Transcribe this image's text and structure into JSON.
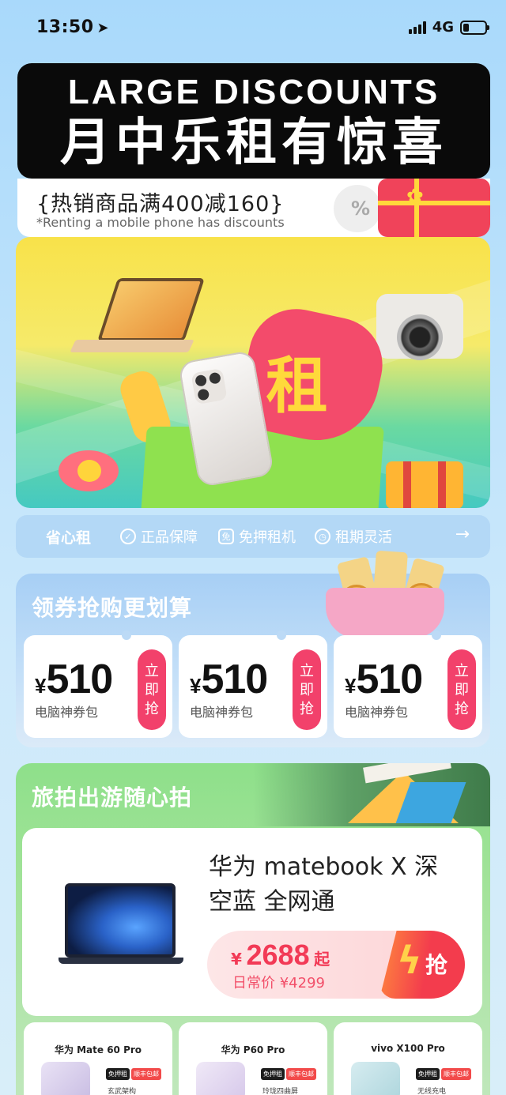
{
  "status_bar": {
    "time": "13:50",
    "network": "4G",
    "battery_level": 0.25
  },
  "headline": {
    "english": "LARGE DISCOUNTS",
    "chinese": "月中乐租有惊喜"
  },
  "promo": {
    "main": "{热销商品满400减160}",
    "sub": "*Renting a mobile phone has discounts",
    "deco_symbol": "%"
  },
  "hero": {
    "sign_char": "租"
  },
  "service_bar": {
    "brand": "省心租",
    "items": [
      {
        "icon": "shield-check-icon",
        "label": "正品保障"
      },
      {
        "icon": "deposit-free-icon",
        "label": "免押租机"
      },
      {
        "icon": "clock-icon",
        "label": "租期灵活"
      }
    ],
    "arrow": "→"
  },
  "coupons": {
    "title": "领券抢购更划算",
    "items": [
      {
        "currency": "¥",
        "amount": "510",
        "label": "电脑神券包",
        "button": "立即抢"
      },
      {
        "currency": "¥",
        "amount": "510",
        "label": "电脑神券包",
        "button": "立即抢"
      },
      {
        "currency": "¥",
        "amount": "510",
        "label": "电脑神券包",
        "button": "立即抢"
      }
    ]
  },
  "travel": {
    "title": "旅拍出游随心拍",
    "featured": {
      "name": "华为 matebook X 深空蓝 全网通",
      "currency": "¥",
      "price": "2688",
      "price_suffix": "起",
      "original_price": "日常价 ¥4299",
      "button": "抢"
    },
    "minis": [
      {
        "name": "华为 Mate 60 Pro",
        "tag1": "免押租",
        "tag2": "顺丰包邮",
        "feature": "玄武架构"
      },
      {
        "name": "华为 P60 Pro",
        "tag1": "免押租",
        "tag2": "顺丰包邮",
        "feature": "玲珑四曲屏"
      },
      {
        "name": "vivo X100 Pro",
        "tag1": "免押租",
        "tag2": "顺丰包邮",
        "feature": "无线充电"
      }
    ]
  },
  "colors": {
    "accent_red": "#f2416b",
    "price_red": "#f23a56",
    "coupon_bg": "#a7cff5",
    "travel_bg": "#8ee08a",
    "gift_red": "#f0435a",
    "ribbon_yellow": "#ffd93b"
  }
}
